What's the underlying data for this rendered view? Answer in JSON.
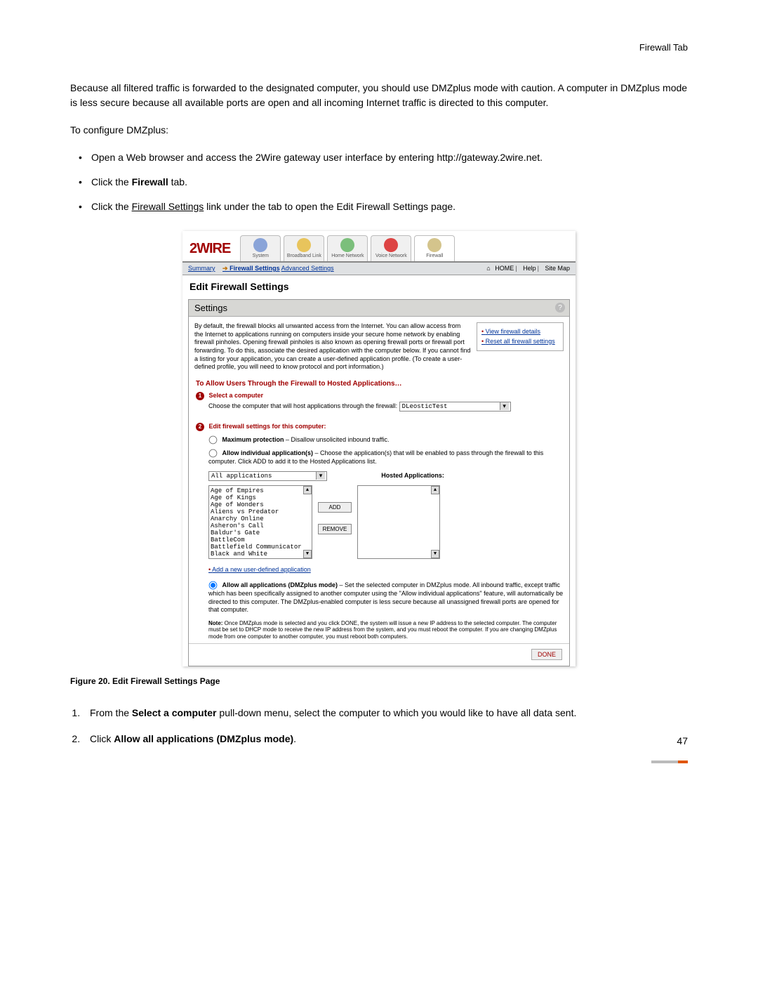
{
  "header": {
    "tab_label": "Firewall Tab"
  },
  "intro": {
    "p1": "Because all filtered traffic is forwarded to the designated computer, you should use DMZplus mode with caution. A computer in DMZplus mode is less secure because all available ports are open and all incoming Internet traffic is directed to this computer.",
    "p2": "To configure DMZplus:"
  },
  "bullets": {
    "b1a": "Open a Web browser and access the 2Wire gateway user interface by entering http://gateway.2wire.net.",
    "b2a": "Click the ",
    "b2b": "Firewall",
    "b2c": " tab.",
    "b3a": "Click the ",
    "b3b": "Firewall Settings",
    "b3c": " link under the tab to open the Edit Firewall Settings page."
  },
  "shot": {
    "logo": "2WIRE",
    "tabs": {
      "system": "System",
      "broadband": "Broadband Link",
      "home": "Home Network",
      "voice": "Voice Network",
      "firewall": "Firewall"
    },
    "subnav": {
      "summary": "Summary",
      "fws": "Firewall Settings",
      "adv": "Advanced Settings",
      "home": "HOME",
      "help": "Help",
      "sitemap": "Site Map"
    },
    "title": "Edit Firewall Settings",
    "panel": {
      "head": "Settings",
      "intro": "By default, the firewall blocks all unwanted access from the Internet. You can allow access from the Internet to applications running on computers inside your secure home network by enabling firewall pinholes. Opening firewall pinholes is also known as opening firewall ports or firewall port forwarding. To do this, associate the desired application with the computer below. If you cannot find a listing for your application, you can create a user-defined application profile. (To create a user-defined profile, you will need to know protocol and port information.)",
      "side1": "View firewall details",
      "side2": "Reset all firewall settings"
    },
    "section_red": "To Allow Users Through the Firewall to Hosted Applications…",
    "step1": {
      "title": "Select a computer",
      "text": "Choose the computer that will host applications through the firewall:",
      "value": "DLeosticTest"
    },
    "step2": {
      "title": "Edit firewall settings for this computer:"
    },
    "radio": {
      "r1_label": "Maximum protection",
      "r1_desc": " – Disallow unsolicited inbound traffic.",
      "r2_label": "Allow individual application(s)",
      "r2_desc": " – Choose the application(s) that will be enabled to pass through the firewall to this computer. Click ADD to add it to the Hosted Applications list.",
      "r3_label": "Allow all applications (DMZplus mode)",
      "r3_desc": " –  Set the selected computer in DMZplus mode. All inbound traffic, except traffic which has been specifically assigned to another computer using the \"Allow individual applications\" feature, will automatically be directed to this computer. The DMZplus-enabled computer is less secure because all unassigned firewall ports are opened for that computer."
    },
    "apps": {
      "dropdown": "All applications",
      "list": [
        "Age of Empires",
        "Age of Kings",
        "Age of Wonders",
        "Aliens vs Predator",
        "Anarchy Online",
        "Asheron's Call",
        "Baldur's Gate",
        "BattleCom",
        "Battlefield Communicator",
        "Black and White"
      ],
      "add": "ADD",
      "remove": "REMOVE",
      "hosted_label": "Hosted Applications:",
      "add_link": "Add a new user-defined application"
    },
    "note_label": "Note:",
    "note_text": " Once DMZplus mode is selected and you click DONE, the system will issue a new IP address to the selected computer. The computer must be set to DHCP mode to receive the new IP address from the system, and you must reboot the computer. If you are changing DMZplus mode from one computer to another computer, you must reboot both computers.",
    "done": "DONE"
  },
  "figure_caption": "Figure 20. Edit Firewall Settings Page",
  "steps": {
    "s1a": "From the ",
    "s1b": "Select a computer",
    "s1c": " pull-down menu, select the computer to which you would like to have all data sent.",
    "s2a": "Click ",
    "s2b": "Allow all applications (DMZplus mode)",
    "s2c": "."
  },
  "page_number": "47"
}
